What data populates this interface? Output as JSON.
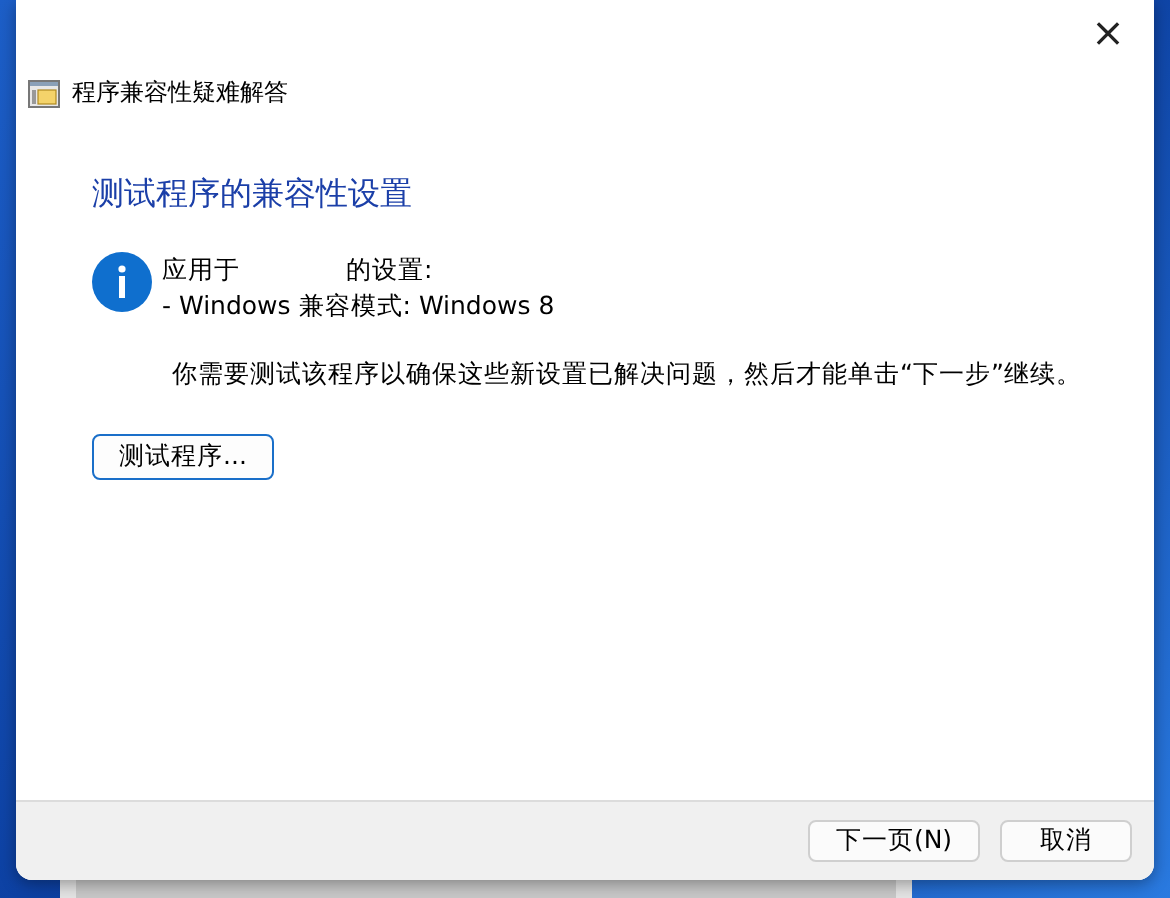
{
  "window": {
    "title": "程序兼容性疑难解答",
    "close_label": "×"
  },
  "heading": "测试程序的兼容性设置",
  "info": {
    "applied_prefix": "应用于",
    "applied_suffix": "的设置:",
    "setting": "- Windows 兼容模式: Windows 8"
  },
  "instruction": "你需要测试该程序以确保这些新设置已解决问题，然后才能单击“下一步”继续。",
  "test_button": "测试程序...",
  "footer_buttons": [
    {
      "label": "下一页(N)"
    },
    {
      "label": "取消"
    }
  ]
}
